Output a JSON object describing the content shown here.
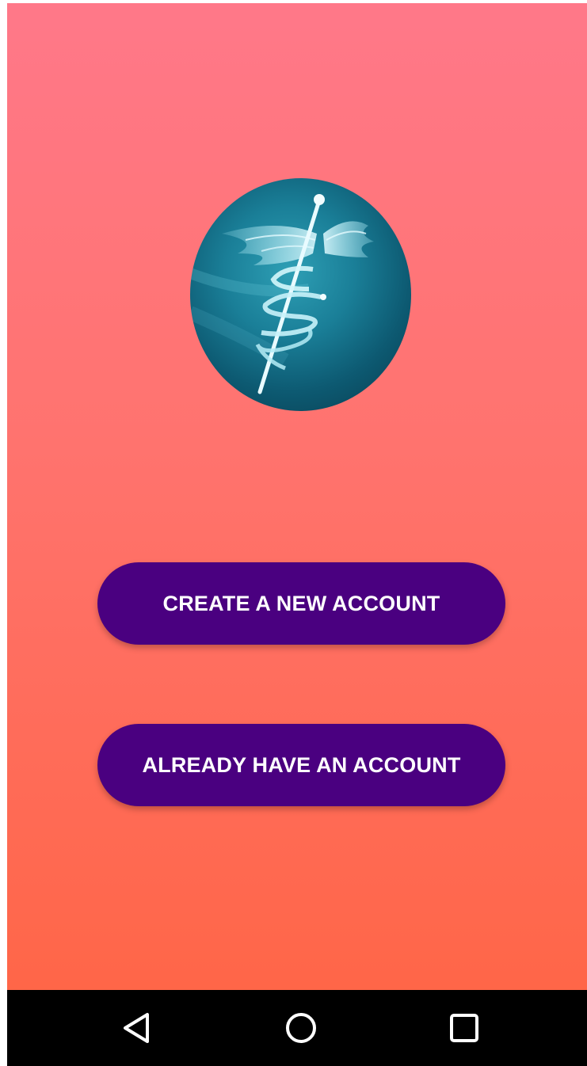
{
  "app": {
    "logo_icon": "caduceus-medical-icon",
    "background_top_color": "#ff7889",
    "background_bottom_color": "#ff6648",
    "button_color": "#4a0080"
  },
  "buttons": {
    "create_label": "CREATE A NEW ACCOUNT",
    "existing_label": "ALREADY HAVE AN ACCOUNT"
  },
  "navbar": {
    "back_icon": "back-triangle-icon",
    "home_icon": "home-circle-icon",
    "recent_icon": "recent-apps-square-icon"
  }
}
